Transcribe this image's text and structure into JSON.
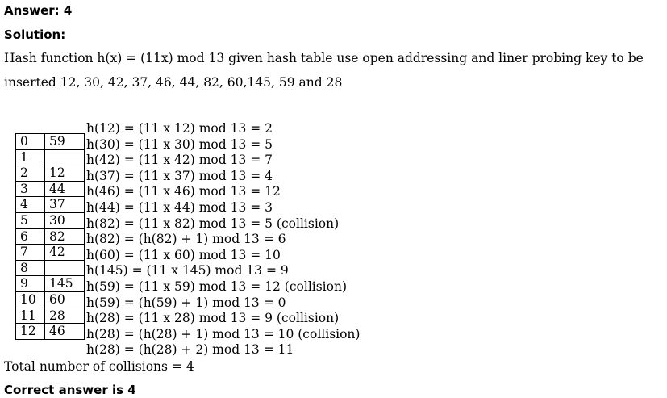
{
  "answer": "Answer: 4",
  "solution_label": "Solution:",
  "intro_line1": "Hash function h(x) = (11x) mod 13 given hash table use open addressing and liner probing key to be",
  "intro_line2": "inserted 12, 30, 42, 37, 46, 44, 82, 60,145, 59 and 28",
  "hash_table": [
    {
      "index": "0",
      "value": "59"
    },
    {
      "index": "1",
      "value": ""
    },
    {
      "index": "2",
      "value": "12"
    },
    {
      "index": "3",
      "value": "44"
    },
    {
      "index": "4",
      "value": "37"
    },
    {
      "index": "5",
      "value": "30"
    },
    {
      "index": "6",
      "value": "82"
    },
    {
      "index": "7",
      "value": "42"
    },
    {
      "index": "8",
      "value": ""
    },
    {
      "index": "9",
      "value": "145"
    },
    {
      "index": "10",
      "value": "60"
    },
    {
      "index": "11",
      "value": "28"
    },
    {
      "index": "12",
      "value": "46"
    }
  ],
  "equations": [
    "h(12) = (11 x 12) mod 13 = 2",
    "h(30) = (11 x 30) mod 13 = 5",
    "h(42) = (11 x 42) mod 13 = 7",
    "h(37) = (11 x 37) mod 13 = 4",
    "h(46) = (11 x 46) mod 13 = 12",
    "h(44) = (11 x 44) mod 13 = 3",
    "h(82) = (11 x 82) mod 13 = 5 (collision)",
    "h(82) = (h(82) + 1) mod 13 = 6",
    "h(60) = (11 x 60) mod 13 = 10",
    "h(145) = (11 x 145) mod 13 = 9",
    "h(59) = (11 x 59) mod 13 = 12 (collision)",
    "h(59) = (h(59) + 1) mod 13 = 0",
    "h(28) = (11 x 28) mod 13 = 9 (collision)",
    "h(28) = (h(28) + 1) mod 13 = 10 (collision)",
    "h(28) = (h(28) + 2) mod 13 = 11"
  ],
  "total": "Total number of collisions = 4",
  "correct": "Correct answer is 4"
}
